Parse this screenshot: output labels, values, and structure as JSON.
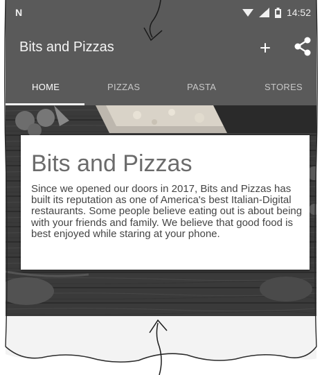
{
  "status_bar": {
    "notification": "N",
    "time": "14:52"
  },
  "app_bar": {
    "title": "Bits and Pizzas",
    "actions": [
      "add-icon",
      "share-icon"
    ]
  },
  "tabs": [
    {
      "label": "HOME",
      "active": true
    },
    {
      "label": "PIZZAS",
      "active": false
    },
    {
      "label": "PASTA",
      "active": false
    },
    {
      "label": "STORES",
      "active": false
    }
  ],
  "hero": {
    "title": "Bits and Pizzas",
    "text": "Since we opened our doors in 2017, Bits and Pizzas has built its reputation as one of America's best Italian-Digital restaurants. Some people believe eating out is about being with your friends and family. We believe that good food is best enjoyed while staring at your phone."
  },
  "colors": {
    "toolbar": "#5a5a5a",
    "hero_bg": "#3b3b3b",
    "card": "#ffffff"
  }
}
